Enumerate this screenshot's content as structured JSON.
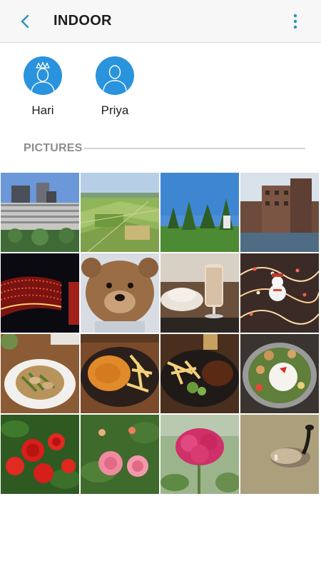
{
  "header": {
    "title": "INDOOR",
    "back_icon": "back-arrow-icon",
    "more_icon": "more-vertical-icon",
    "accent": "#2a93b8"
  },
  "people": [
    {
      "name": "Hari",
      "avatar_icon": "person-crown-icon"
    },
    {
      "name": "Priya",
      "avatar_icon": "person-icon"
    }
  ],
  "section": {
    "label": "PICTURES"
  },
  "photos": [
    "buildings-skyline",
    "green-fields",
    "park-trees",
    "brick-apartments",
    "lit-bridge-night",
    "teddy-bear",
    "milkshake-glass",
    "fairy-lights-snowman",
    "stir-fry-plate",
    "curry-fries-skillet",
    "steak-fries-plate",
    "rice-dish-plate",
    "red-roses",
    "pink-roses",
    "pink-celosia-flower",
    "goose-on-water"
  ]
}
